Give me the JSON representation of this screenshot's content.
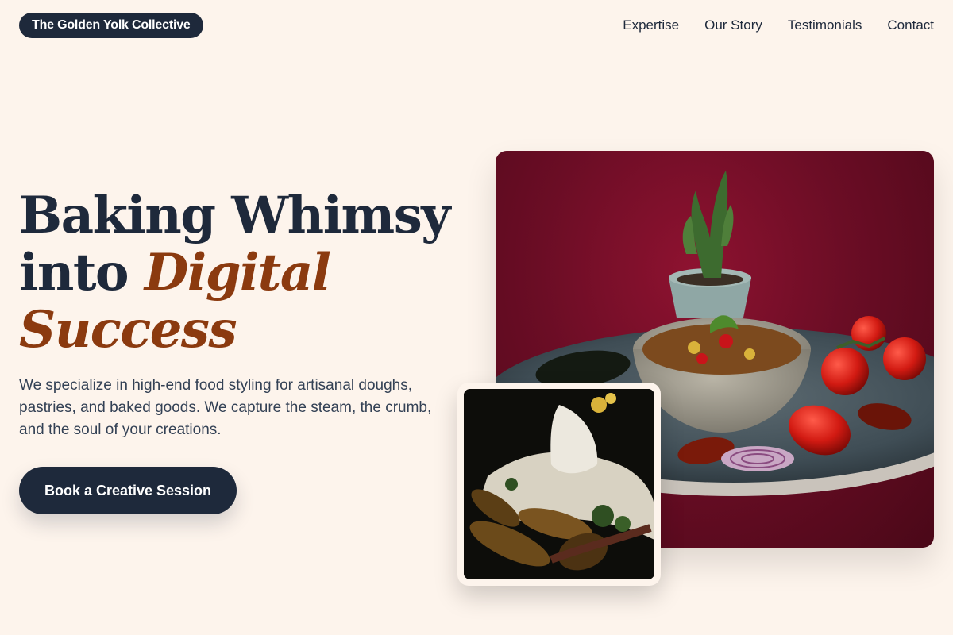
{
  "header": {
    "brand": "The Golden Yolk Collective",
    "nav": [
      "Expertise",
      "Our Story",
      "Testimonials",
      "Contact"
    ]
  },
  "hero": {
    "headline_line1": "Baking Whimsy",
    "headline_line2_plain": "into ",
    "headline_line2_accent": "Digital",
    "headline_line3_accent": "Success",
    "lead": "We specialize in high-end food styling for artisanal doughs, pastries, and baked goods. We capture the steam, the crumb, and the soul of your creations.",
    "cta_label": "Book a Creative Session"
  },
  "images": {
    "main_alt": "Plated stew with red peppers, onion and a small potted cactus on a crimson backdrop",
    "inset_alt": "Roasted corn cobs with a white floral pitcher on a dark backdrop"
  },
  "colors": {
    "background": "#fdf4ec",
    "navy": "#1e293b",
    "accent": "#8b3a0f",
    "crimson": "#7a0f29"
  }
}
